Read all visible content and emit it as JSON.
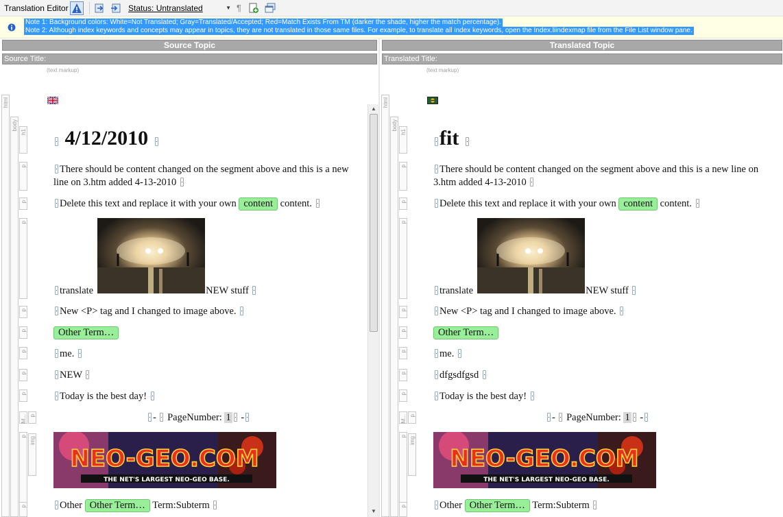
{
  "toolbar": {
    "title": "Translation Editor",
    "status_label": "Status: Untranslated",
    "pilcrow": "¶",
    "icons": [
      "info-icon",
      "import-icon",
      "export-icon",
      "paragraph-marks-icon",
      "add-document-icon",
      "window-icon"
    ]
  },
  "notes": {
    "note1": "Note 1: Background colors: White=Not Translated; Gray=Translated/Accepted; Red=Match Exists From TM (darker the shade, higher the match percentage).",
    "note2": "Note 2: Although index keywords and concepts may appear in topics, they are not translated in those same files. For example, to translate all index keywords, open the Index.liindexmap file from the File List window pane."
  },
  "source": {
    "header": "Source Topic",
    "title_label": "Source Title:",
    "markup_hint": "(text markup)",
    "tags": {
      "html": "html",
      "body": "body",
      "h1": "h1",
      "p": "p",
      "m": "M...",
      "img": "img"
    },
    "h1": "4/12/2010",
    "p1": "There should be content changed on the segment above and this is a new line on 3.htm added 4-13-2010",
    "p2_a": "Delete this text and replace it with your own",
    "p2_term": "content",
    "p2_b": "content.",
    "p3_a": "translate",
    "p3_b": "NEW stuff",
    "p4": "New <P> tag and I changed to image above.",
    "p5_term": "Other Term…",
    "p6": "me.",
    "p7": "NEW",
    "p8": "Today is the best day!",
    "pg_dash1": "-",
    "pg_label": "PageNumber:",
    "pg_num": "1",
    "pg_dash2": "-",
    "last_a": "Other",
    "last_term": "Other Term…",
    "last_b": "Term:Subterm"
  },
  "target": {
    "header": "Translated Topic",
    "title_label": "Translated Title:",
    "markup_hint": "(text markup)",
    "tags": {
      "html": "html",
      "body": "body",
      "h1": "h1",
      "p": "p",
      "m": "M...",
      "img": "img"
    },
    "h1": "fit",
    "p1": "There should be content changed on the segment above and this is a new line on 3.htm added 4-13-2010",
    "p2_a": "Delete this text and replace it with your own",
    "p2_term": "content",
    "p2_b": "content.",
    "p3_a": "translate",
    "p3_b": "NEW stuff",
    "p4": "New <P> tag and I changed to image above.",
    "p5_term": "Other Term…",
    "p6": "me.",
    "p7": "dfgsdfgsd",
    "p8": "Today is the best day!",
    "pg_dash1": "-",
    "pg_label": "PageNumber:",
    "pg_num": "1",
    "pg_dash2": "-",
    "last_a": "Other",
    "last_term": "Other Term…",
    "last_b": "Term:Subterm"
  },
  "banner_text": {
    "main": "NEO-GEO.COM",
    "tagline": "THE NET'S LARGEST NEO-GEO BASE."
  },
  "colors": {
    "green_term": "#99ee99",
    "selection": "#3399ff",
    "header_bar": "#a8a8a8",
    "notes_bg": "#ffffe6"
  }
}
